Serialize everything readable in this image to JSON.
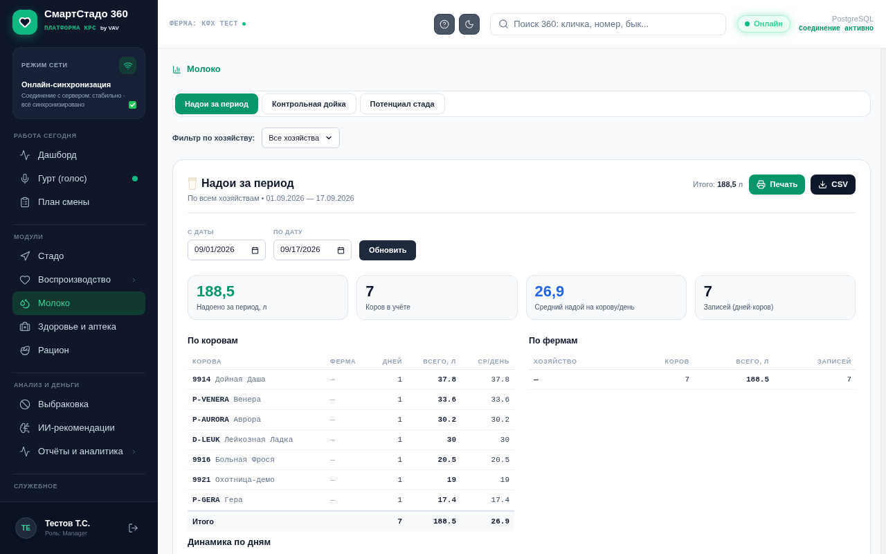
{
  "sidebar": {
    "brand": {
      "title": "СмартСтадо 360",
      "subtitle": "ПЛАТФОРМА КРС",
      "byline": "by VAV"
    },
    "network": {
      "label": "РЕЖИМ СЕТИ",
      "title": "Онлайн-синхронизация",
      "text": "Соединение с сервером: стабильно · всё синхронизировано"
    },
    "sections": [
      {
        "title": "РАБОТА СЕГОДНЯ",
        "items": [
          {
            "label": "Дашборд",
            "selected": false,
            "status_dot": false,
            "submenu": false
          },
          {
            "label": "Гурт (голос)",
            "selected": false,
            "status_dot": true,
            "submenu": false
          },
          {
            "label": "План смены",
            "selected": false,
            "status_dot": false,
            "submenu": false
          }
        ]
      },
      {
        "title": "МОДУЛИ",
        "items": [
          {
            "label": "Стадо",
            "selected": false,
            "status_dot": false,
            "submenu": false
          },
          {
            "label": "Воспроизводство",
            "selected": false,
            "status_dot": false,
            "submenu": true
          },
          {
            "label": "Молоко",
            "selected": true,
            "status_dot": false,
            "submenu": false
          },
          {
            "label": "Здоровье и аптека",
            "selected": false,
            "status_dot": false,
            "submenu": false
          },
          {
            "label": "Рацион",
            "selected": false,
            "status_dot": false,
            "submenu": false
          }
        ]
      },
      {
        "title": "АНАЛИЗ И ДЕНЬГИ",
        "items": [
          {
            "label": "Выбраковка",
            "selected": false,
            "status_dot": false,
            "submenu": false
          },
          {
            "label": "ИИ-рекомендации",
            "selected": false,
            "status_dot": false,
            "submenu": false
          },
          {
            "label": "Отчёты и аналитика",
            "selected": false,
            "status_dot": false,
            "submenu": true
          }
        ]
      },
      {
        "title": "СЛУЖЕБНОЕ"
      }
    ],
    "user": {
      "initials": "ТЕ",
      "name": "Тестов Т.С.",
      "role": "Роль: Manager"
    }
  },
  "header": {
    "farm": "ФЕРМА: КФХ ТЕСТ",
    "search": {
      "placeholder": "Поиск 360: кличка, номер, бык..."
    },
    "status": {
      "label": "Онлайн",
      "online": true
    },
    "database": {
      "name": "PostgreSQL",
      "status": "Соединение активно"
    }
  },
  "page": {
    "title": "Молоко",
    "tabs": [
      {
        "label": "Надои за период",
        "selected": true
      },
      {
        "label": "Контрольная дойка",
        "selected": false
      },
      {
        "label": "Потенциал стада",
        "selected": false
      }
    ],
    "filter": {
      "label": "Фильтр по хозяйству:",
      "value": "Все хозяйства"
    }
  },
  "report": {
    "title": "Надои за период",
    "subtitle": "По всем хозяйствам • 01.09.2026 — 17.09.2026",
    "total": "Итого: **188,5** л",
    "buttons": [
      {
        "kind": "print",
        "label": "Печать"
      },
      {
        "kind": "csv",
        "label": "CSV"
      }
    ],
    "dates": [
      {
        "label": "С ДАТЫ",
        "value": "09/01/2026"
      },
      {
        "label": "ПО ДАТУ",
        "value": "09/17/2026"
      }
    ],
    "refresh": "Обновить",
    "stats": [
      {
        "value": "188,5",
        "label": "Надоено за период, л",
        "color": "#059669"
      },
      {
        "value": "7",
        "label": "Коров в учёте",
        "color": "#0f172a"
      },
      {
        "value": "26,9",
        "label": "Средний надой на корову/день",
        "color": "#2563eb"
      },
      {
        "value": "7",
        "label": "Записей (дней·коров)",
        "color": "#0f172a"
      }
    ]
  },
  "cow_table": {
    "title": "По коровам",
    "columns": [
      "КОРОВА",
      "ФЕРМА",
      "ДНЕЙ",
      "ВСЕГО, Л",
      "СР/ДЕНЬ"
    ],
    "rows": [
      {
        "cow": "**9914** Дойная Даша",
        "farm": "—",
        "days": "1",
        "total": "37.8",
        "average": "37.8"
      },
      {
        "cow": "**P-VENERA** Венера",
        "farm": "—",
        "days": "1",
        "total": "33.6",
        "average": "33.6"
      },
      {
        "cow": "**P-AURORA** Аврора",
        "farm": "—",
        "days": "1",
        "total": "30.2",
        "average": "30.2"
      },
      {
        "cow": "**D-LEUK** Лейкозная Ладка",
        "farm": "—",
        "days": "1",
        "total": "30",
        "average": "30"
      },
      {
        "cow": "**9916** Больная Фрося",
        "farm": "—",
        "days": "1",
        "total": "20.5",
        "average": "20.5"
      },
      {
        "cow": "**9921** Охотница-демо",
        "farm": "—",
        "days": "1",
        "total": "19",
        "average": "19"
      },
      {
        "cow": "**P-GERA** Гера",
        "farm": "—",
        "days": "1",
        "total": "17.4",
        "average": "17.4"
      }
    ],
    "footer": {
      "label": "Итого",
      "days": "7",
      "total": "188.5",
      "average": "26.9"
    }
  },
  "farm_table": {
    "title": "По фермам",
    "columns": [
      "ХОЗЯЙСТВО",
      "КОРОВ",
      "ВСЕГО, Л",
      "ЗАПИСЕЙ"
    ],
    "rows": [
      {
        "farm": "—",
        "cows": "7",
        "total": "188.5",
        "records": "7"
      }
    ]
  },
  "next_section": {
    "title": "Динамика по дням"
  }
}
